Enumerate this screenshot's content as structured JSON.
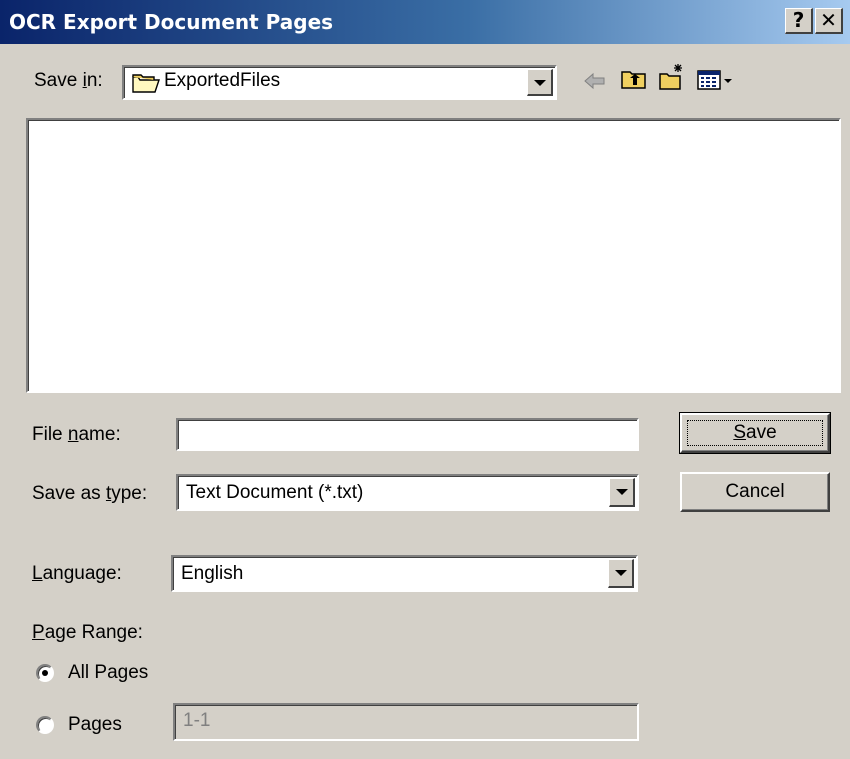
{
  "window": {
    "title": "OCR Export Document Pages",
    "help_btn": "?",
    "close_btn": "✕"
  },
  "save_in": {
    "label_pre": "Save ",
    "label_accel": "i",
    "label_post": "n:",
    "folder": "ExportedFiles"
  },
  "toolbar": {
    "icons": [
      "back-arrow-icon",
      "up-folder-icon",
      "new-folder-icon",
      "view-menu-icon"
    ]
  },
  "file_name": {
    "label_pre": "File ",
    "label_accel": "n",
    "label_post": "ame:",
    "value": ""
  },
  "save_type": {
    "label_pre": "Save as ",
    "label_accel": "t",
    "label_post": "ype:",
    "value": "Text Document (*.txt)"
  },
  "language": {
    "label_pre": "",
    "label_accel": "L",
    "label_post": "anguage:",
    "value": "English"
  },
  "page_range": {
    "label_pre": "",
    "label_accel": "P",
    "label_post": "age Range:",
    "all_pages_label": "All Pages",
    "pages_label": "Pages",
    "pages_value": "1-1",
    "selected": "All Pages"
  },
  "buttons": {
    "save_accel": "S",
    "save_rest": "ave",
    "cancel": "Cancel"
  },
  "colors": {
    "titlebar_start": "#0a246a",
    "titlebar_end": "#a6caf0",
    "dialog_bg": "#d4d0c8"
  }
}
